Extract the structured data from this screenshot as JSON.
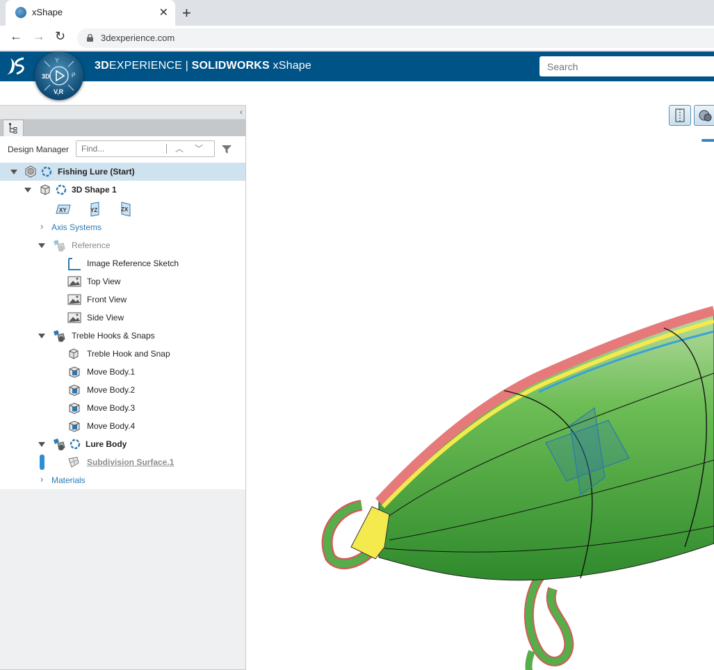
{
  "browser": {
    "tab_title": "xShape",
    "url": "3dexperience.com"
  },
  "app": {
    "title_part1": "3D",
    "title_part2": "EXPERIENCE",
    "title_sep": " | ",
    "title_part3": "SOLIDWORKS",
    "title_part4": " xShape",
    "search_placeholder": "Search",
    "compass_labels": [
      "3D",
      "V,R",
      "i³"
    ]
  },
  "panel": {
    "design_manager_label": "Design Manager",
    "find_placeholder": "Find...",
    "tree": [
      {
        "label": "Fishing Lure (Start)",
        "icon": "assembly-icon"
      },
      {
        "label": "3D Shape 1",
        "icon": "shape-icon"
      },
      {
        "label": "Axis Systems",
        "icon": "none"
      },
      {
        "label": "Reference",
        "icon": "geometric-set-icon"
      },
      {
        "label": "Image Reference Sketch",
        "icon": "sketch-icon"
      },
      {
        "label": "Top View",
        "icon": "image-icon"
      },
      {
        "label": "Front View",
        "icon": "image-icon"
      },
      {
        "label": "Side View",
        "icon": "image-icon"
      },
      {
        "label": "Treble Hooks & Snaps",
        "icon": "geometric-set-icon"
      },
      {
        "label": "Treble Hook and Snap",
        "icon": "body-icon"
      },
      {
        "label": "Move Body.1",
        "icon": "move-body-icon"
      },
      {
        "label": "Move Body.2",
        "icon": "move-body-icon"
      },
      {
        "label": "Move Body.3",
        "icon": "move-body-icon"
      },
      {
        "label": "Move Body.4",
        "icon": "move-body-icon"
      },
      {
        "label": "Lure Body",
        "icon": "geometric-set-icon"
      },
      {
        "label": "Subdivision Surface.1",
        "icon": "subdivision-icon"
      },
      {
        "label": "Materials",
        "icon": "none"
      }
    ],
    "planes": [
      "XY",
      "YZ",
      "ZX"
    ]
  },
  "colors": {
    "appbar": "#005386",
    "lure_green": "#5bb548",
    "lure_red": "#e67a7a",
    "lure_yellow": "#f4ea4e",
    "accent_blue": "#2a79b0"
  }
}
